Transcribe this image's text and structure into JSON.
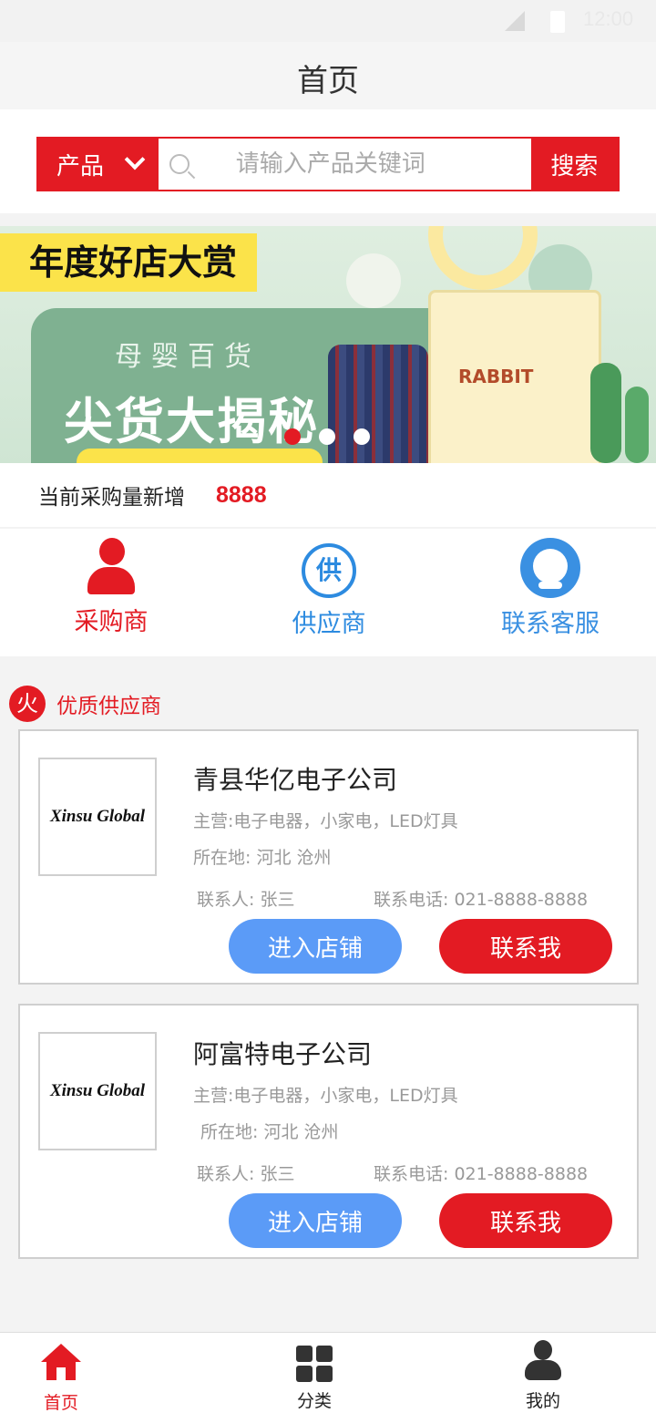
{
  "status_bar": {
    "time": "12:00"
  },
  "header": {
    "title": "首页"
  },
  "search": {
    "category": "产品",
    "placeholder": "请输入产品关键词",
    "value": "",
    "button_label": "搜索"
  },
  "banner": {
    "tag": "年度好店大赏",
    "subtitle": "母婴百货",
    "headline": "尖货大揭秘",
    "brand": "RABBIT",
    "active_slide": 1,
    "slide_count": 3
  },
  "stats": {
    "label": "当前采购量新增",
    "value": "8888"
  },
  "roles": [
    {
      "label": "采购商",
      "icon": "buyer-icon"
    },
    {
      "label": "供应商",
      "icon": "supplier-icon",
      "glyph": "供"
    },
    {
      "label": "联系客服",
      "icon": "headset-icon"
    }
  ],
  "section": {
    "badge": "火",
    "title": "优质供应商"
  },
  "suppliers": [
    {
      "logo": "Xinsu Global",
      "name": "青县华亿电子公司",
      "main_business": "主营:电子电器，小家电，LED灯具",
      "location": "所在地:  河北  沧州",
      "contact": "联系人:  张三",
      "phone": "联系电话:  021-8888-8888",
      "shop_label": "进入店铺",
      "contact_label": "联系我"
    },
    {
      "logo": "Xinsu Global",
      "name": "阿富特电子公司",
      "main_business": "主营:电子电器，小家电，LED灯具",
      "location": "所在地: 河北 沧州",
      "contact": "联系人:  张三",
      "phone": "联系电话:  021-8888-8888",
      "shop_label": "进入店铺",
      "contact_label": "联系我"
    }
  ],
  "tabs": [
    {
      "label": "首页",
      "icon": "home-icon",
      "active": true
    },
    {
      "label": "分类",
      "icon": "grid-icon",
      "active": false
    },
    {
      "label": "我的",
      "icon": "user-icon",
      "active": false
    }
  ],
  "colors": {
    "brand": "#e31b23",
    "accent_blue": "#5b9bf7",
    "supplier_blue": "#2d8be0"
  }
}
